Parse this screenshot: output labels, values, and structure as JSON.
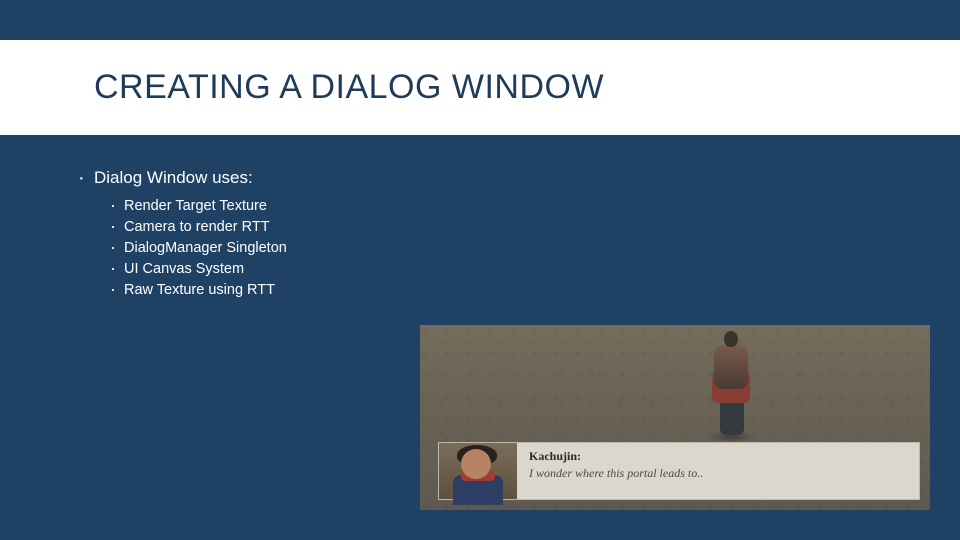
{
  "title": "CREATING A DIALOG WINDOW",
  "bullet_main": "Dialog Window uses:",
  "sub_bullets": [
    "Render Target Texture",
    "Camera to render RTT",
    "DialogManager Singleton",
    "UI Canvas System",
    "Raw Texture using RTT"
  ],
  "dialog_speaker": "Kachujin:",
  "dialog_line": "I wonder where this portal leads to.."
}
